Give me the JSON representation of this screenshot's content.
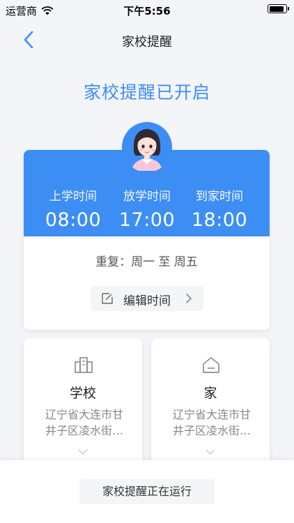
{
  "statusbar": {
    "carrier": "运营商",
    "time": "下午5:56",
    "battery_level": 0.95
  },
  "nav": {
    "title": "家校提醒",
    "back_icon": "chevron-left-icon"
  },
  "headline": "家校提醒已开启",
  "times": [
    {
      "label": "上学时间",
      "value": "08:00"
    },
    {
      "label": "放学时间",
      "value": "17:00"
    },
    {
      "label": "到家时间",
      "value": "18:00"
    }
  ],
  "repeat": "重复：周一 至 周五",
  "edit_button": {
    "label": "编辑时间",
    "icon": "edit-icon"
  },
  "locations": [
    {
      "title": "学校",
      "address": "辽宁省大连市甘井子区凌水街…",
      "icon": "school-building-icon"
    },
    {
      "title": "家",
      "address": "辽宁省大连市甘井子区凌水街…",
      "icon": "home-icon"
    }
  ],
  "footer_status": "家校提醒正在运行",
  "colors": {
    "accent": "#3d8ef4",
    "background": "#f3f5f8"
  }
}
